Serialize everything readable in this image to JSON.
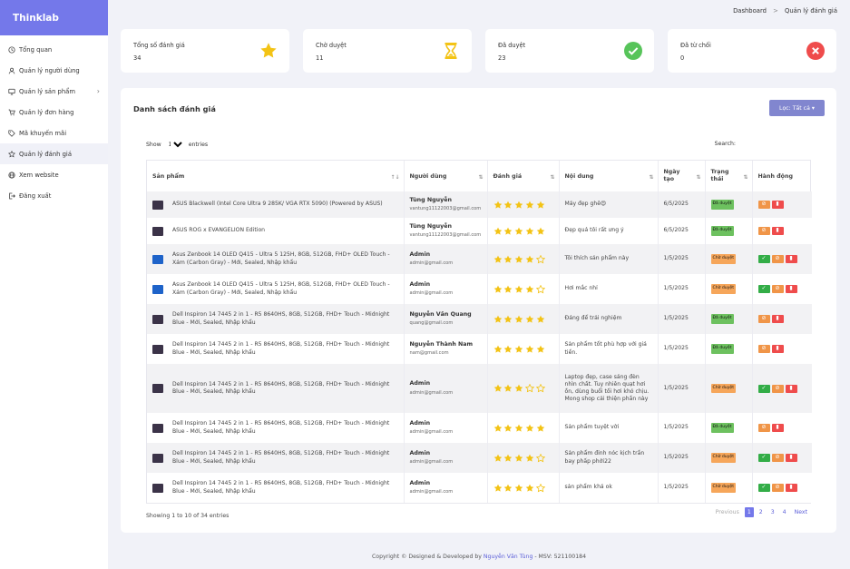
{
  "brand": "Thinklab",
  "nav": [
    {
      "label": "Tổng quan",
      "icon": "clock-icon"
    },
    {
      "label": "Quản lý người dùng",
      "icon": "user-icon"
    },
    {
      "label": "Quản lý sản phẩm",
      "icon": "monitor-icon"
    },
    {
      "label": "Quản lý đơn hàng",
      "icon": "cart-icon"
    },
    {
      "label": "Mã khuyến mãi",
      "icon": "tag-icon"
    },
    {
      "label": "Quản lý đánh giá",
      "icon": "star-outline-icon"
    },
    {
      "label": "Xem website",
      "icon": "globe-icon"
    },
    {
      "label": "Đăng xuất",
      "icon": "logout-icon"
    }
  ],
  "breadcrumb": {
    "root": "Dashboard",
    "separator": ">",
    "current": "Quản lý đánh giá"
  },
  "stats": [
    {
      "label": "Tổng số đánh giá",
      "value": "34",
      "icon": "star-icon",
      "color": "#f3c315"
    },
    {
      "label": "Chờ duyệt",
      "value": "11",
      "icon": "hourglass-icon",
      "color": "#f3c315"
    },
    {
      "label": "Đã duyệt",
      "value": "23",
      "icon": "check-circle-icon",
      "color": "#57c45a"
    },
    {
      "label": "Đã từ chối",
      "value": "0",
      "icon": "x-circle-icon",
      "color": "#ef4c4c"
    }
  ],
  "panel": {
    "title": "Danh sách đánh giá",
    "filter_button": "Lọc: Tất cả ▾",
    "show_label": "Show",
    "show_value": "10",
    "entries_label": "entries",
    "search_label": "Search:",
    "showing_text": "Showing 1 to 10 of 34 entries"
  },
  "columns": [
    "Sản phẩm",
    "Người dùng",
    "Đánh giá",
    "Nội dung",
    "Ngày tạo",
    "Trạng thái",
    "Hành động"
  ],
  "rows": [
    {
      "product": "ASUS Blackwell (Intel Core Ultra 9 285K/ VGA RTX 5090) (Powered by ASUS)",
      "thumb": "dark",
      "user": "Tùng Nguyễn",
      "email": "vantung11122003@gmail.com",
      "rating": 5,
      "content": "Máy đẹp ghê😍",
      "date": "6/5/2025",
      "status": "Đã duyệt",
      "status_type": "ok"
    },
    {
      "product": "ASUS ROG x EVANGELION Edition",
      "thumb": "dark",
      "user": "Tùng Nguyễn",
      "email": "vantung11122003@gmail.com",
      "rating": 5,
      "content": "Đẹp quá tôi rất ưng ý",
      "date": "6/5/2025",
      "status": "Đã duyệt",
      "status_type": "ok"
    },
    {
      "product": "Asus Zenbook 14 OLED Q415 - Ultra 5 125H, 8GB, 512GB, FHD+ OLED Touch - Xám (Carbon Gray) - Mới, Sealed, Nhập khẩu",
      "thumb": "blue",
      "user": "Admin",
      "email": "admin@gmail.com",
      "rating": 4,
      "content": "Tôi thích sản phẩm này",
      "date": "1/5/2025",
      "status": "Chờ duyệt",
      "status_type": "wait"
    },
    {
      "product": "Asus Zenbook 14 OLED Q415 - Ultra 5 125H, 8GB, 512GB, FHD+ OLED Touch - Xám (Carbon Gray) - Mới, Sealed, Nhập khẩu",
      "thumb": "blue",
      "user": "Admin",
      "email": "admin@gmail.com",
      "rating": 4,
      "content": "Hơi mắc nhỉ",
      "date": "1/5/2025",
      "status": "Chờ duyệt",
      "status_type": "wait"
    },
    {
      "product": "Dell Inspiron 14 7445 2 in 1 - R5 8640HS, 8GB, 512GB, FHD+ Touch - Midnight Blue - Mới, Sealed, Nhập khẩu",
      "thumb": "dark",
      "user": "Nguyễn Văn Quang",
      "email": "quang@gmail.com",
      "rating": 5,
      "content": "Đáng để trải nghiệm",
      "date": "1/5/2025",
      "status": "Đã duyệt",
      "status_type": "ok"
    },
    {
      "product": "Dell Inspiron 14 7445 2 in 1 - R5 8640HS, 8GB, 512GB, FHD+ Touch - Midnight Blue - Mới, Sealed, Nhập khẩu",
      "thumb": "dark",
      "user": "Nguyễn Thành Nam",
      "email": "nam@gmail.com",
      "rating": 5,
      "content": "Sản phẩm tốt phù hợp với giá tiền.",
      "date": "1/5/2025",
      "status": "Đã duyệt",
      "status_type": "ok"
    },
    {
      "product": "Dell Inspiron 14 7445 2 in 1 - R5 8640HS, 8GB, 512GB, FHD+ Touch - Midnight Blue - Mới, Sealed, Nhập khẩu",
      "thumb": "dark",
      "user": "Admin",
      "email": "admin@gmail.com",
      "rating": 3,
      "content": "Laptop đẹp, case sáng đèn nhìn chất. Tuy nhiên quạt hơi ồn, dùng buổi tối hơi khó chịu. Mong shop cải thiện phần này",
      "date": "1/5/2025",
      "status": "Chờ duyệt",
      "status_type": "wait"
    },
    {
      "product": "Dell Inspiron 14 7445 2 in 1 - R5 8640HS, 8GB, 512GB, FHD+ Touch - Midnight Blue - Mới, Sealed, Nhập khẩu",
      "thumb": "dark",
      "user": "Admin",
      "email": "admin@gmail.com",
      "rating": 5,
      "content": "Sản phẩm tuyệt vời",
      "date": "1/5/2025",
      "status": "Đã duyệt",
      "status_type": "ok"
    },
    {
      "product": "Dell Inspiron 14 7445 2 in 1 - R5 8640HS, 8GB, 512GB, FHD+ Touch - Midnight Blue - Mới, Sealed, Nhập khẩu",
      "thumb": "dark",
      "user": "Admin",
      "email": "admin@gmail.com",
      "rating": 4,
      "content": "Sản phẩm đỉnh nóc kịch trần bay phấp phới22",
      "date": "1/5/2025",
      "status": "Chờ duyệt",
      "status_type": "wait"
    },
    {
      "product": "Dell Inspiron 14 7445 2 in 1 - R5 8640HS, 8GB, 512GB, FHD+ Touch - Midnight Blue - Mới, Sealed, Nhập khẩu",
      "thumb": "dark",
      "user": "Admin",
      "email": "admin@gmail.com",
      "rating": 4,
      "content": "sản phẩm khá ok",
      "date": "1/5/2025",
      "status": "Chờ duyệt",
      "status_type": "wait"
    }
  ],
  "pagination": {
    "previous": "Previous",
    "pages": [
      "1",
      "2",
      "3",
      "4"
    ],
    "current": "1",
    "next": "Next"
  },
  "footer": {
    "prefix": "Copyright © Designed & Developed by ",
    "author": "Nguyễn Văn Tùng",
    "suffix": " - MSV: 521100184"
  },
  "colors": {
    "brand": "#7478ea",
    "star": "#f3c315",
    "approved": "#6dc15f",
    "pending": "#f6a65a",
    "delete": "#ef4c4c"
  }
}
